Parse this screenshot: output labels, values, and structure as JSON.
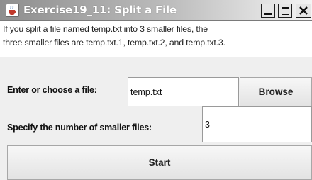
{
  "window": {
    "title": "Exercise19_11: Split a File",
    "icon": "java-cup-icon",
    "controls": [
      "minimize",
      "maximize",
      "close"
    ]
  },
  "description": {
    "line1": "If you split a file named temp.txt into 3 smaller files, the",
    "line2": "three smaller files are temp.txt.1, temp.txt.2, and temp.txt.3."
  },
  "file_row": {
    "label": "Enter or choose a file:",
    "value": "temp.txt",
    "browse_label": "Browse"
  },
  "count_row": {
    "label": "Specify the number of smaller files:",
    "value": "3"
  },
  "start_label": "Start"
}
